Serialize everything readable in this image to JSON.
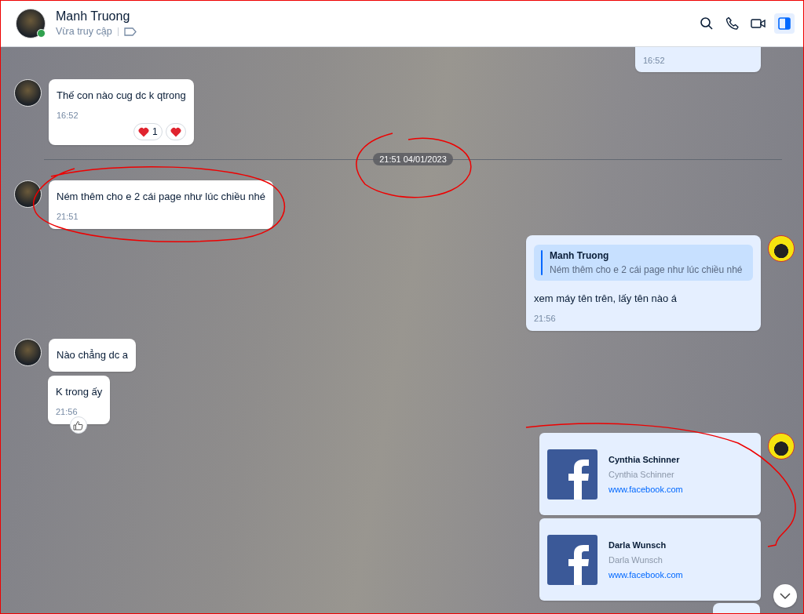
{
  "header": {
    "name": "Manh Truong",
    "status": "Vừa truy cập",
    "online": true,
    "sidebar_open": true
  },
  "messages": [
    {
      "kind": "fragment",
      "outgoing": true,
      "time": "16:52"
    },
    {
      "kind": "text",
      "outgoing": false,
      "avatar": true,
      "text": "Thế con nào cug dc k qtrong",
      "time": "16:52",
      "reactions": [
        {
          "kind": "count",
          "count": "1"
        },
        {
          "kind": "quick"
        }
      ]
    },
    {
      "kind": "divider",
      "label": "21:51 04/01/2023"
    },
    {
      "kind": "text",
      "outgoing": false,
      "avatar": true,
      "text": "Ném thêm cho e 2 cái page như lúc chiều nhé",
      "time": "21:51"
    },
    {
      "kind": "quote",
      "outgoing": true,
      "avatar": true,
      "quote_author": "Manh Truong",
      "quote_text": "Ném thêm cho e 2 cái page như lúc chiều nhé",
      "text": "xem máy tên trên, lấy tên nào á",
      "time": "21:56"
    },
    {
      "kind": "text",
      "outgoing": false,
      "avatar": true,
      "text": "Nào chẳng dc a"
    },
    {
      "kind": "text",
      "outgoing": false,
      "avatar": false,
      "text": "K trong ấy",
      "time": "21:56",
      "liked": true
    },
    {
      "kind": "link",
      "outgoing": true,
      "avatar": true,
      "title": "Cynthia Schinner",
      "subtitle": "Cynthia Schinner",
      "url": "www.facebook.com"
    },
    {
      "kind": "link",
      "outgoing": true,
      "avatar": false,
      "title": "Darla Wunsch",
      "subtitle": "Darla Wunsch",
      "url": "www.facebook.com"
    },
    {
      "kind": "fragment-bottom",
      "outgoing": true
    }
  ]
}
